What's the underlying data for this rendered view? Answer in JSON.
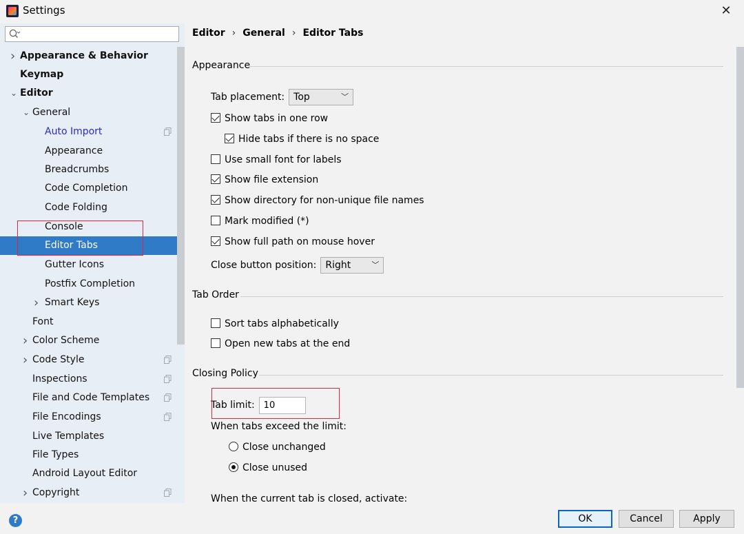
{
  "window": {
    "title": "Settings",
    "close": "✕"
  },
  "search": {
    "placeholder": ""
  },
  "sidebar": {
    "items": [
      {
        "label": "Appearance & Behavior",
        "arrow": "›",
        "bold": true
      },
      {
        "label": "Keymap",
        "bold": true
      },
      {
        "label": "Editor",
        "arrow": "⌄",
        "bold": true
      },
      {
        "label": "General",
        "arrow": "⌄"
      },
      {
        "label": "Auto Import",
        "link": true,
        "copy": true
      },
      {
        "label": "Appearance"
      },
      {
        "label": "Breadcrumbs"
      },
      {
        "label": "Code Completion"
      },
      {
        "label": "Code Folding"
      },
      {
        "label": "Console"
      },
      {
        "label": "Editor Tabs",
        "selected": true
      },
      {
        "label": "Gutter Icons"
      },
      {
        "label": "Postfix Completion"
      },
      {
        "label": "Smart Keys",
        "arrow": "›"
      },
      {
        "label": "Font"
      },
      {
        "label": "Color Scheme",
        "arrow": "›"
      },
      {
        "label": "Code Style",
        "arrow": "›",
        "copy": true
      },
      {
        "label": "Inspections",
        "copy": true
      },
      {
        "label": "File and Code Templates",
        "copy": true
      },
      {
        "label": "File Encodings",
        "copy": true
      },
      {
        "label": "Live Templates"
      },
      {
        "label": "File Types"
      },
      {
        "label": "Android Layout Editor"
      },
      {
        "label": "Copyright",
        "arrow": "›",
        "copy": true
      }
    ]
  },
  "breadcrumb": {
    "part1": "Editor",
    "part2": "General",
    "part3": "Editor Tabs",
    "sep": "›"
  },
  "appearance": {
    "title": "Appearance",
    "tab_placement_label": "Tab placement:",
    "tab_placement_value": "Top",
    "show_tabs_one_row": "Show tabs in one row",
    "hide_tabs_no_space": "Hide tabs if there is no space",
    "small_font_labels": "Use small font for labels",
    "show_file_extension": "Show file extension",
    "show_directory": "Show directory for non-unique file names",
    "mark_modified": "Mark modified (*)",
    "show_full_path": "Show full path on mouse hover",
    "close_button_label": "Close button position:",
    "close_button_value": "Right"
  },
  "tab_order": {
    "title": "Tab Order",
    "sort_alpha": "Sort tabs alphabetically",
    "open_at_end": "Open new tabs at the end"
  },
  "closing_policy": {
    "title": "Closing Policy",
    "tab_limit_label": "Tab limit:",
    "tab_limit_value": "10",
    "exceed_label": "When tabs exceed the limit:",
    "close_unchanged": "Close unchanged",
    "close_unused": "Close unused",
    "activate_label": "When the current tab is closed, activate:"
  },
  "footer": {
    "help": "?",
    "ok": "OK",
    "cancel": "Cancel",
    "apply": "Apply"
  },
  "colors": {
    "selection": "#2f7bc8",
    "highlight_box": "#e3263a",
    "link": "#2929d6"
  }
}
